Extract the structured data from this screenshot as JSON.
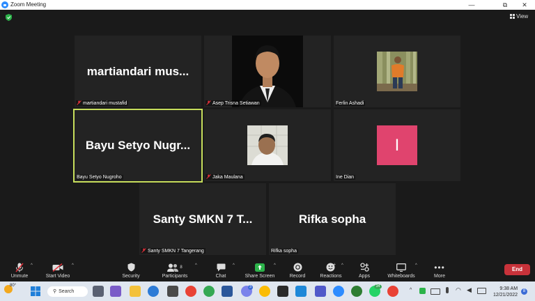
{
  "window": {
    "title": "Zoom Meeting",
    "minimize": "—",
    "maximize": "⧉",
    "close": "✕"
  },
  "header": {
    "view_label": "View"
  },
  "tiles": [
    {
      "big_name": "martiandari  mus...",
      "label": "martiandari mustafid"
    },
    {
      "label": "Asep Trisna Setiawan"
    },
    {
      "label": "Ferlin Ashadi"
    },
    {
      "big_name": "Bayu Setyo Nugr...",
      "label": "Bayu Setyo Nugroho"
    },
    {
      "label": "Jaka Maulana"
    },
    {
      "avatar_letter": "I",
      "label": "Ine Dian"
    },
    {
      "big_name": "Santy SMKN 7 T...",
      "label": "Santy SMKN 7 Tangerang"
    },
    {
      "big_name": "Rifka sopha",
      "label": "Rifka sopha"
    }
  ],
  "toolbar": {
    "unmute": "Unmute",
    "start_video": "Start Video",
    "security": "Security",
    "participants": "Participants",
    "participant_count": "8",
    "chat": "Chat",
    "share_screen": "Share Screen",
    "record": "Record",
    "reactions": "Reactions",
    "apps": "Apps",
    "whiteboards": "Whiteboards",
    "more": "More",
    "end": "End"
  },
  "taskbar": {
    "weather_temp": "80°",
    "search_label": "Search",
    "time": "9:38 AM",
    "date": "12/21/2022",
    "notification_count": "8",
    "app_badge_1": "3",
    "app_badge_2": "34"
  },
  "colors": {
    "active_speaker": "#c7de5c",
    "share_green": "#2cb34a",
    "end_red": "#c8323a",
    "avatar_pink": "#e0446e",
    "zoom_blue": "#2D8CFF"
  }
}
